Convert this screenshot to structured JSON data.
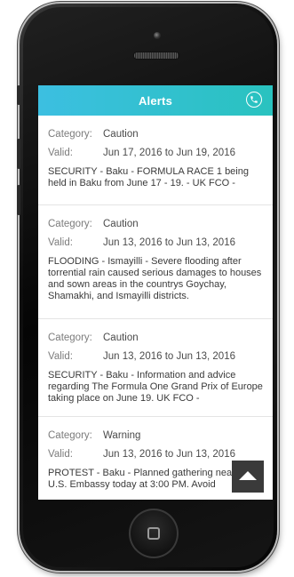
{
  "header": {
    "title": "Alerts",
    "call_icon": "phone-icon"
  },
  "labels": {
    "category": "Category:",
    "valid": "Valid:"
  },
  "alerts": [
    {
      "category": "Caution",
      "valid": "Jun 17, 2016 to Jun 19, 2016",
      "description": "SECURITY - Baku - FORMULA RACE 1 being held in Baku from June 17 - 19.  - UK FCO -"
    },
    {
      "category": "Caution",
      "valid": "Jun 13, 2016 to Jun 13, 2016",
      "description": "FLOODING - Ismayilli - Severe flooding after torrential rain caused serious damages to houses and sown areas in the countrys Goychay, Shamakhi, and Ismayilli districts."
    },
    {
      "category": "Caution",
      "valid": "Jun 13, 2016 to Jun 13, 2016",
      "description": "SECURITY - Baku - Information and advice regarding The Formula One Grand Prix of Europe taking place on June 19. UK FCO -"
    },
    {
      "category": "Warning",
      "valid": "Jun 13, 2016 to Jun 13, 2016",
      "description": "PROTEST - Baku - Planned gathering near the U.S. Embassy today at 3:00 PM. Avoid"
    }
  ],
  "scroll_top_icon": "arrow-up-icon",
  "home_icon": "home-button-icon",
  "colors": {
    "header_start": "#3cbfe1",
    "header_end": "#29c2bf",
    "scroll_button": "#3a3a3a"
  }
}
